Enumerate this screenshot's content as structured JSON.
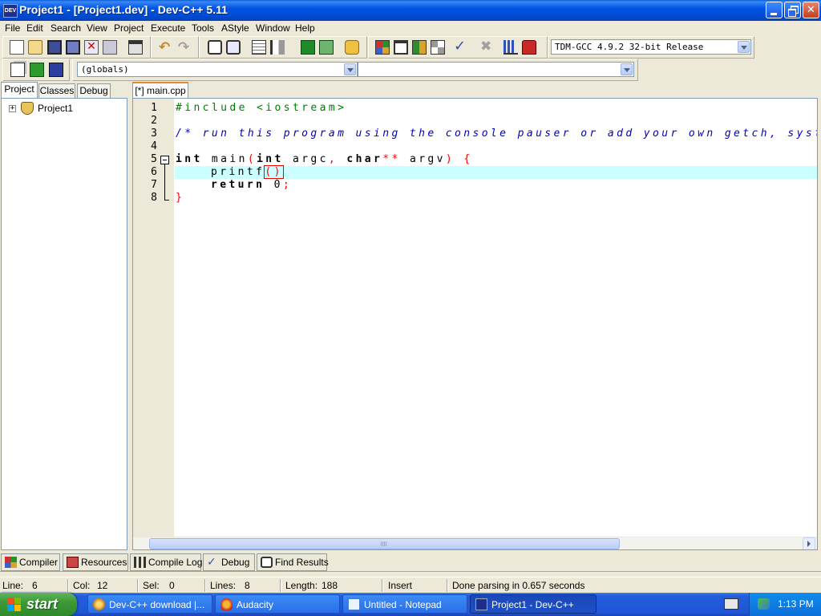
{
  "window": {
    "title": "Project1 - [Project1.dev] - Dev-C++ 5.11",
    "icon_text": "DEV"
  },
  "menu": [
    "File",
    "Edit",
    "Search",
    "View",
    "Project",
    "Execute",
    "Tools",
    "AStyle",
    "Window",
    "Help"
  ],
  "toolbar": {
    "compiler_select": "TDM-GCC 4.9.2 32-bit Release",
    "scope_select": "(globals)",
    "function_select": ""
  },
  "left_panel": {
    "tabs": [
      "Project",
      "Classes",
      "Debug"
    ],
    "tree_root": "Project1"
  },
  "editor": {
    "tab_label": "[*] main.cpp",
    "line_numbers": [
      "1",
      "2",
      "3",
      "4",
      "5",
      "6",
      "7",
      "8"
    ],
    "lines": {
      "l1": "#include <iostream>",
      "l3": "/* run this program using the console pauser or add your own getch, syste",
      "l5_kw1": "int",
      "l5_name": " main",
      "l5_p1": "(",
      "l5_kw2": "int",
      "l5_a1": " argc",
      "l5_comma": ",",
      "l5_kw3": " char",
      "l5_stars": "**",
      "l5_a2": " argv",
      "l5_p2": ")",
      "l5_brace": " {",
      "l6_call": "printf",
      "l6_paren": "()",
      "l7_kw": "return",
      "l7_num": " 0",
      "l7_semi": ";",
      "l8": "}"
    }
  },
  "bottom_tabs": [
    "Compiler",
    "Resources",
    "Compile Log",
    "Debug",
    "Find Results"
  ],
  "status": {
    "line_label": "Line:",
    "line_value": "6",
    "col_label": "Col:",
    "col_value": "12",
    "sel_label": "Sel:",
    "sel_value": "0",
    "lines_label": "Lines:",
    "lines_value": "8",
    "length_label": "Length:",
    "length_value": "188",
    "mode": "Insert",
    "message": "Done parsing in 0.657 seconds"
  },
  "taskbar": {
    "start": "start",
    "tasks": [
      "Dev-C++ download |...",
      "Audacity",
      "Untitled - Notepad",
      "Project1 - Dev-C++"
    ],
    "clock": "1:13 PM"
  }
}
